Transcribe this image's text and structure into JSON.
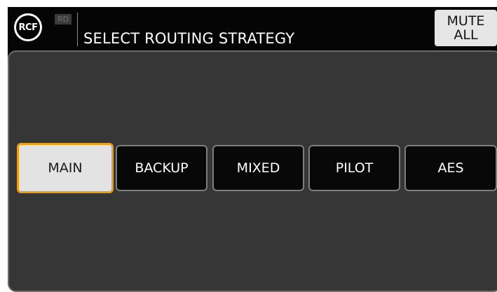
{
  "header": {
    "logo_text": "RCF",
    "badge": "RD",
    "title": "SELECT ROUTING STRATEGY",
    "mute_button": {
      "line1": "MUTE",
      "line2": "ALL"
    }
  },
  "strategies": [
    {
      "label": "MAIN",
      "selected": true
    },
    {
      "label": "BACKUP",
      "selected": false
    },
    {
      "label": "MIXED",
      "selected": false
    },
    {
      "label": "PILOT",
      "selected": false
    },
    {
      "label": "AES",
      "selected": false
    }
  ],
  "colors": {
    "selected_border": "#e8a01a",
    "selected_fill": "#e3e3e3",
    "panel_background": "#363636",
    "button_background": "#080808"
  }
}
